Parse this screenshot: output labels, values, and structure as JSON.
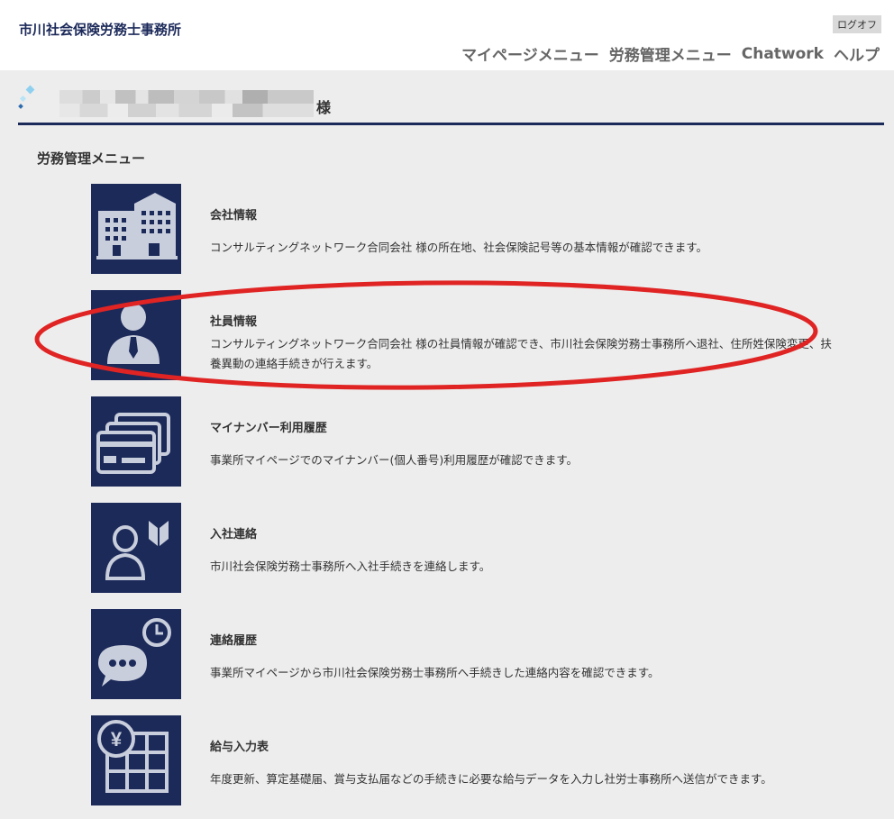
{
  "header": {
    "office_name": "市川社会保険労務士事務所",
    "logoff_label": "ログオフ",
    "nav": [
      {
        "label": "マイページメニュー"
      },
      {
        "label": "労務管理メニュー"
      },
      {
        "label": "Chatwork"
      },
      {
        "label": "ヘルプ"
      }
    ]
  },
  "user": {
    "suffix": "様"
  },
  "section": {
    "title": "労務管理メニュー"
  },
  "menu": [
    {
      "icon": "building-icon",
      "title": "会社情報",
      "desc": "コンサルティングネットワーク合同会社 様の所在地、社会保険記号等の基本情報が確認できます。"
    },
    {
      "icon": "employee-icon",
      "title": "社員情報",
      "desc": "コンサルティングネットワーク合同会社 様の社員情報が確認でき、市川社会保険労務士事務所へ退社、住所姓保険変更、扶養異動の連絡手続きが行えます。"
    },
    {
      "icon": "cards-icon",
      "title": "マイナンバー利用履歴",
      "desc": "事業所マイページでのマイナンバー(個人番号)利用履歴が確認できます。"
    },
    {
      "icon": "new-hire-icon",
      "title": "入社連絡",
      "desc": "市川社会保険労務士事務所へ入社手続きを連絡します。"
    },
    {
      "icon": "chat-clock-icon",
      "title": "連絡履歴",
      "desc": "事業所マイページから市川社会保険労務士事務所へ手続きした連絡内容を確認できます。"
    },
    {
      "icon": "yen-table-icon",
      "title": "給与入力表",
      "desc": "年度更新、算定基礎届、賞与支払届などの手続きに必要な給与データを入力し社労士事務所へ送信ができます。"
    }
  ],
  "colors": {
    "accent": "#1c2a5a",
    "icon_fg": "#c9cedc",
    "highlight": "#e02424"
  }
}
